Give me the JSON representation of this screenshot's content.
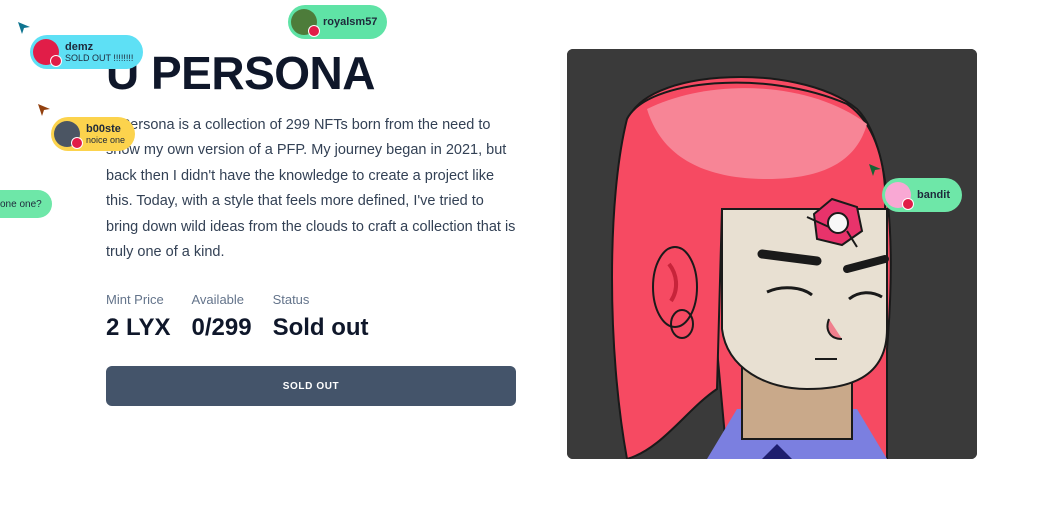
{
  "collection": {
    "title": "U PERSONA",
    "description": "U Persona is a collection of 299 NFTs born from the need to show my own version of a PFP. My journey began in 2021, but back then I didn't have the knowledge to create a project like this. Today, with a style that feels more defined, I've tried to bring down wild ideas from the clouds to craft a collection that is truly one of a kind.",
    "stats": [
      {
        "label": "Mint Price",
        "value": "2 LYX"
      },
      {
        "label": "Available",
        "value": "0/299"
      },
      {
        "label": "Status",
        "value": "Sold out"
      }
    ],
    "button_label": "SOLD OUT"
  },
  "cursors": [
    {
      "name": "demz",
      "message": "SOLD OUT !!!!!!!!",
      "color": "#5ee0f5"
    },
    {
      "name": "royalsm57",
      "message": "",
      "color": "#5fe3a6"
    },
    {
      "name": "b00ste",
      "message": "noice one",
      "color": "#fcd34d"
    },
    {
      "name": "",
      "message": "one one?",
      "color": "#6ee7a8"
    },
    {
      "name": "bandit",
      "message": "",
      "color": "#6ee7a8"
    }
  ],
  "colors": {
    "hair": "#f64a62",
    "skin": "#e8e0d2",
    "art_bg": "#3a3a3a",
    "button": "#44546a"
  },
  "icons": [
    "cursor-arrow-icon",
    "avatar-badge-icon"
  ]
}
